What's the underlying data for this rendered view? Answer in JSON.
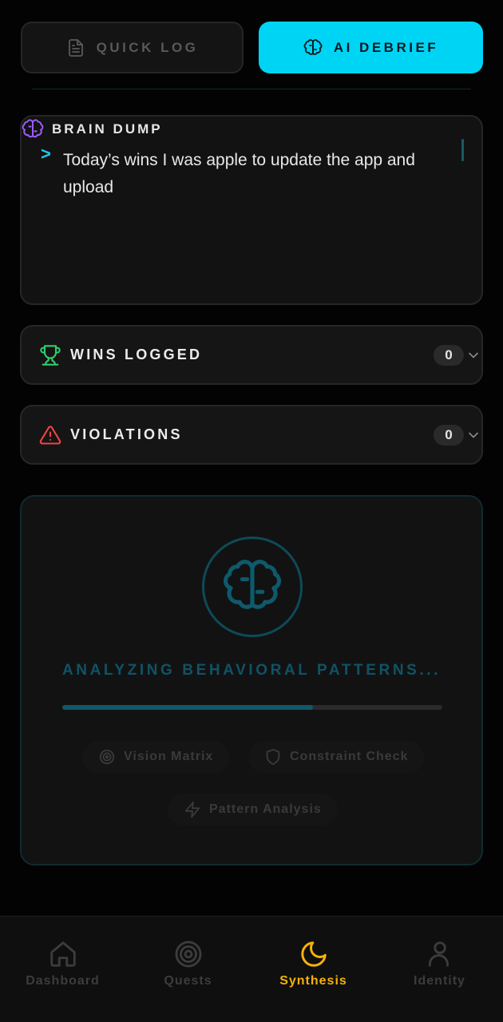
{
  "mode": {
    "quick_log": "QUICK LOG",
    "ai_debrief": "AI DEBRIEF",
    "active": "ai_debrief"
  },
  "brain_dump": {
    "title": "BRAIN DUMP",
    "prompt": ">",
    "text": "Today’s wins I was apple to update the app and upload"
  },
  "wins": {
    "title": "WINS LOGGED",
    "count": "0",
    "icon": "trophy-icon"
  },
  "violations": {
    "title": "VIOLATIONS",
    "count": "0",
    "icon": "alert-triangle-icon"
  },
  "analysis": {
    "status": "ANALYZING BEHAVIORAL PATTERNS...",
    "progress": 0.66,
    "chips": [
      {
        "label": "Vision Matrix",
        "icon": "target-icon"
      },
      {
        "label": "Constraint Check",
        "icon": "shield-icon"
      },
      {
        "label": "Pattern Analysis",
        "icon": "lightning-icon"
      }
    ]
  },
  "nav": {
    "items": [
      {
        "label": "Dashboard",
        "icon": "home-icon"
      },
      {
        "label": "Quests",
        "icon": "target-icon"
      },
      {
        "label": "Synthesis",
        "icon": "moon-icon"
      },
      {
        "label": "Identity",
        "icon": "user-icon"
      }
    ],
    "active": "Synthesis"
  },
  "colors": {
    "accent_cyan": "#00d4f5",
    "nav_active": "#f5b10a",
    "win_green": "#2fcf6a",
    "violation_red": "#ef4444",
    "brain_purple": "#9b5cf6"
  }
}
